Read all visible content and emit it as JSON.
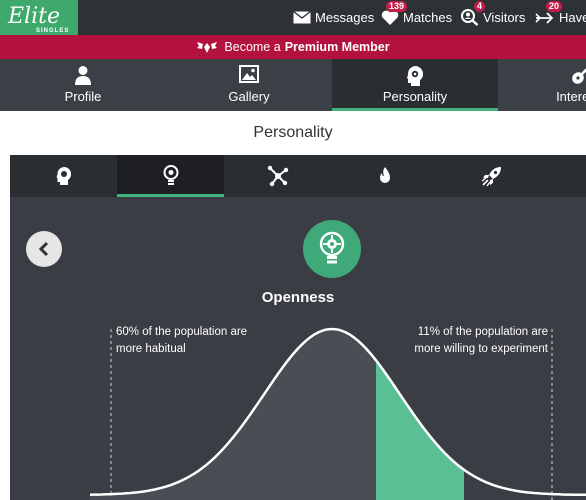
{
  "brand": {
    "name": "Elite",
    "tagline": "SINGLES"
  },
  "nav": {
    "messages": {
      "label": "Messages"
    },
    "matches": {
      "label": "Matches",
      "badge": "139"
    },
    "visitors": {
      "label": "Visitors",
      "badge": "4"
    },
    "have_met": {
      "label": "Have",
      "badge": "20"
    }
  },
  "premium": {
    "prefix": "Become a",
    "highlight": "Premium Member"
  },
  "profile_tabs": [
    {
      "label": "Profile",
      "icon": "person-icon"
    },
    {
      "label": "Gallery",
      "icon": "image-icon"
    },
    {
      "label": "Personality",
      "icon": "head-gear-icon",
      "active": true
    },
    {
      "label": "Interests",
      "icon": "guitar-icon"
    }
  ],
  "section_title": "Personality",
  "trait_tabs": [
    {
      "icon": "head-brain-icon"
    },
    {
      "icon": "lightbulb-icon",
      "active": true
    },
    {
      "icon": "network-icon"
    },
    {
      "icon": "flame-icon"
    },
    {
      "icon": "rocket-icon"
    }
  ],
  "trait": {
    "name": "Openness",
    "left_note": [
      "60% of the population are",
      "more habitual"
    ],
    "right_note": [
      "11% of the population are",
      "more willing to experiment"
    ]
  },
  "colors": {
    "topbar": "#2e3136",
    "brand_green": "#3fa86b",
    "premium_red": "#b3123f",
    "accent_green": "#3fb37b",
    "panel": "#3a3d43",
    "curve_fill_left": "#4a4d53",
    "curve_fill_right": "#5bbf95"
  }
}
